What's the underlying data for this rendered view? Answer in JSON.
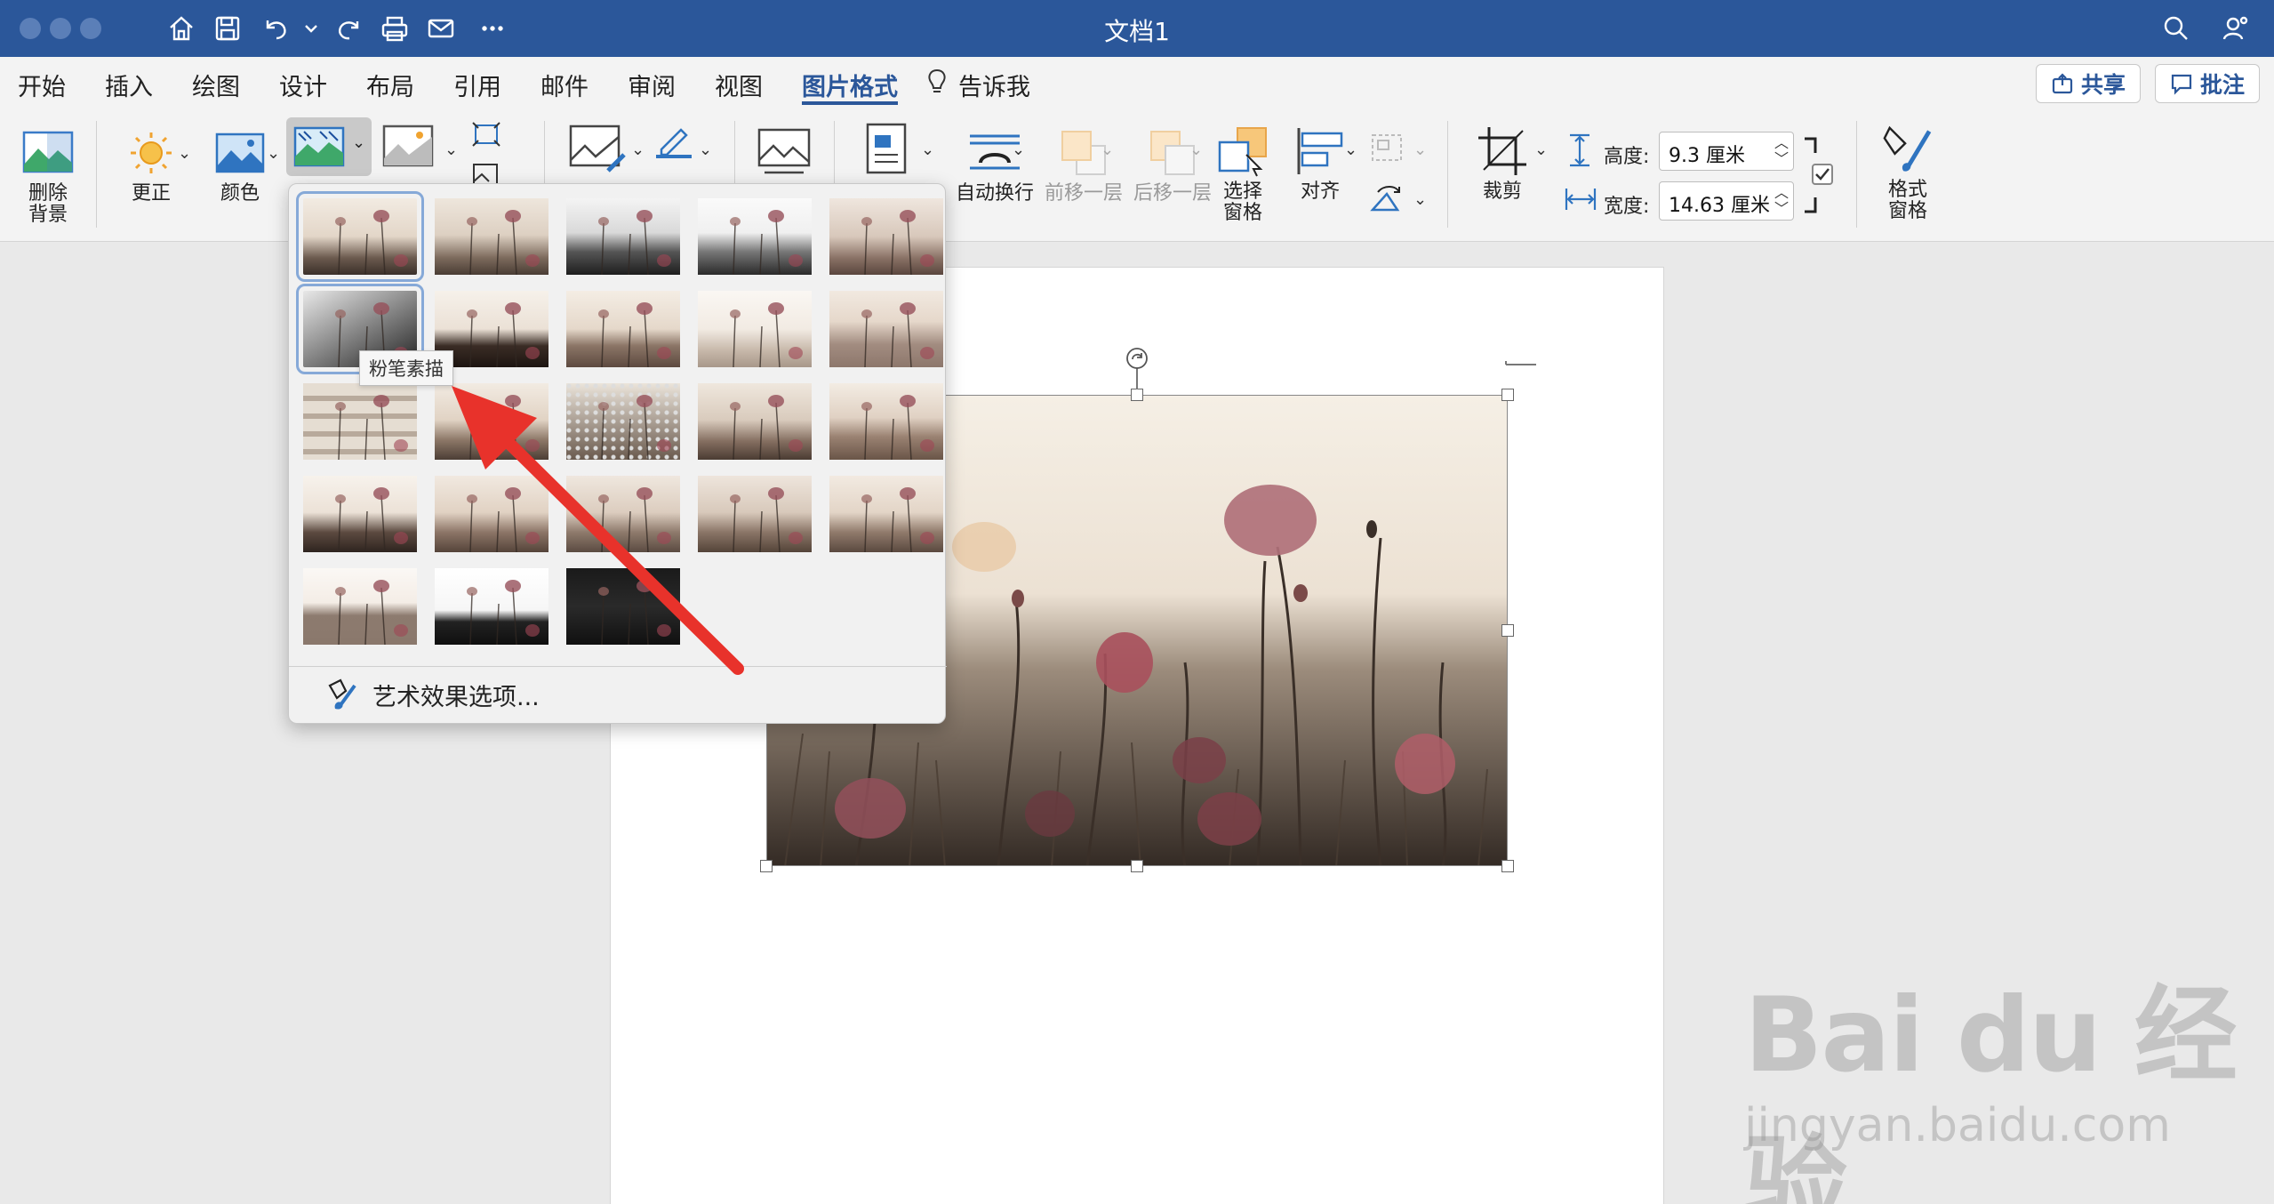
{
  "window": {
    "title": "文档1"
  },
  "tabs": [
    {
      "label": "开始"
    },
    {
      "label": "插入"
    },
    {
      "label": "绘图"
    },
    {
      "label": "设计"
    },
    {
      "label": "布局"
    },
    {
      "label": "引用"
    },
    {
      "label": "邮件"
    },
    {
      "label": "审阅"
    },
    {
      "label": "视图"
    },
    {
      "label": "图片格式"
    }
  ],
  "tell_me": "告诉我",
  "share_label": "共享",
  "comments_label": "批注",
  "ribbon": {
    "remove_bg": "删除\n背景",
    "corrections": "更正",
    "color": "颜色",
    "wrap_text": "自动换行",
    "bring_forward": "前移一层",
    "send_backward": "后移一层",
    "selection_pane": "选择\n窗格",
    "align": "对齐",
    "crop": "裁剪",
    "height_label": "高度:",
    "height_value": "9.3 厘米",
    "width_label": "宽度:",
    "width_value": "14.63 厘米",
    "format_pane": "格式\n窗格"
  },
  "gallery": {
    "options_label": "艺术效果选项...",
    "tooltip": "粉笔素描",
    "selected_index": 5,
    "effects_count": 23
  },
  "watermark": {
    "logo": "Bai du 经验",
    "url": "jingyan.baidu.com"
  },
  "colors": {
    "accent": "#2b579a",
    "ribbon_bg": "#f3f3f3",
    "arrow": "#e8322b"
  }
}
